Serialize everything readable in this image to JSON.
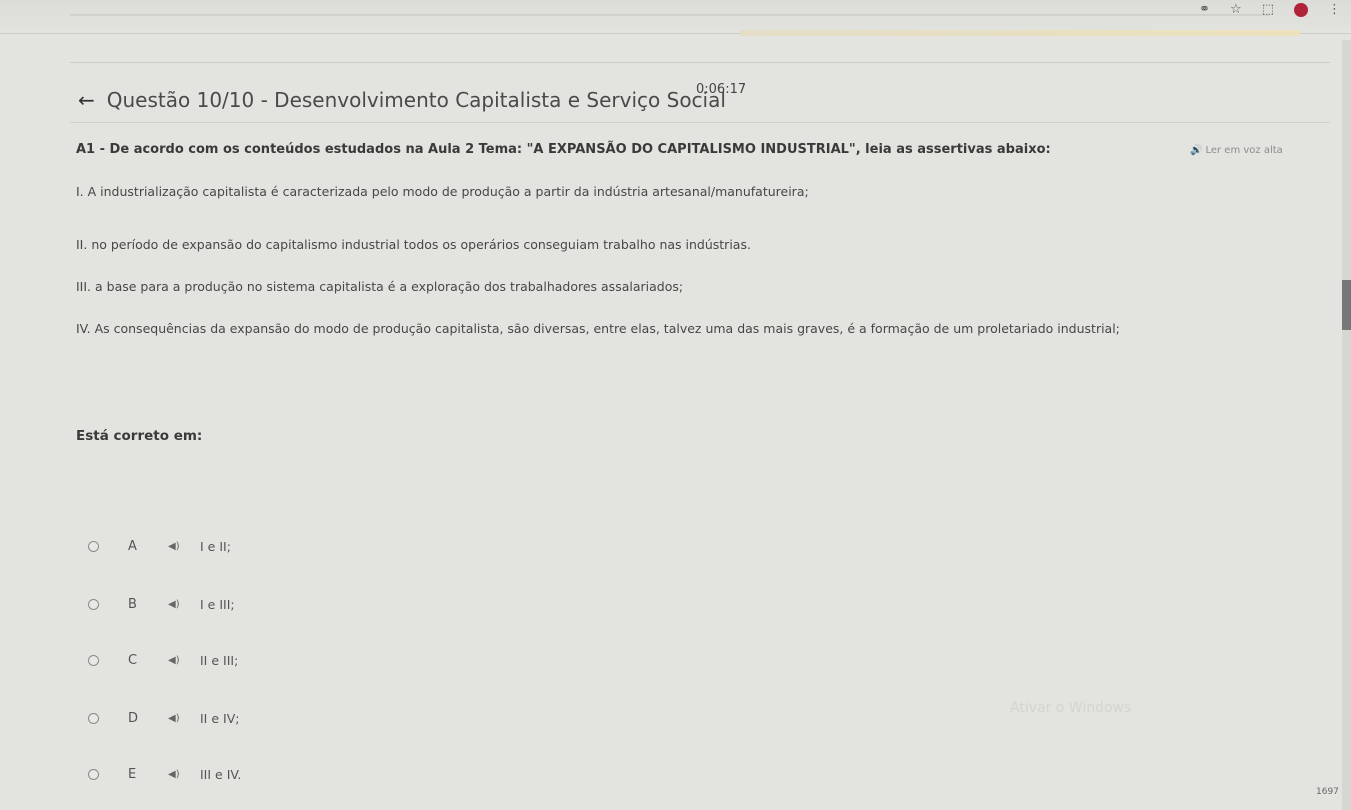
{
  "timer": "0:06:17",
  "header": {
    "title": "Questão 10/10 - Desenvolvimento Capitalista e Serviço Social",
    "back_icon": "arrow-left-icon"
  },
  "read_aloud": "Ler em voz alta",
  "question": {
    "prompt": "A1 - De acordo com os conteúdos estudados na Aula 2 Tema: \"A EXPANSÃO DO CAPITALISMO INDUSTRIAL\", leia as assertivas abaixo:",
    "assertions": [
      "I. A industrialização capitalista é caracterizada pelo modo de produção a partir da indústria artesanal/manufatureira;",
      "II. no período de expansão do capitalismo industrial todos os operários conseguiam trabalho nas indústrias.",
      "III. a base para a produção no sistema capitalista é a exploração dos trabalhadores assalariados;",
      "IV. As consequências da expansão do modo de produção capitalista, são diversas, entre elas, talvez uma das mais graves, é a formação de um proletariado industrial;"
    ],
    "correct_label": "Está correto em:"
  },
  "options": [
    {
      "letter": "A",
      "text": "I e II;"
    },
    {
      "letter": "B",
      "text": "I e III;"
    },
    {
      "letter": "C",
      "text": "II e III;"
    },
    {
      "letter": "D",
      "text": "II e IV;"
    },
    {
      "letter": "E",
      "text": "III e IV."
    }
  ],
  "watermark": "Ativar o Windows",
  "taskbar_time": "1697",
  "colors": {
    "background": "#e3e3df",
    "accent": "#b0243a"
  }
}
